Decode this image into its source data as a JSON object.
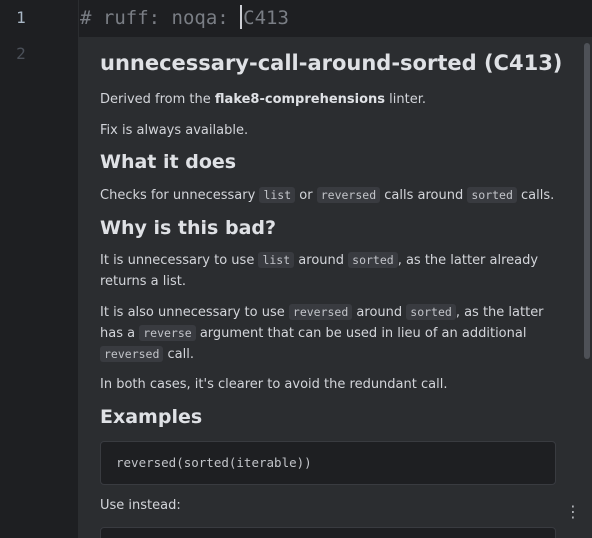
{
  "editor": {
    "line_numbers": [
      "1",
      "2"
    ],
    "line1_before_caret": "# ruff: noqa: ",
    "line1_after_caret": "C413"
  },
  "doc": {
    "title": "unnecessary-call-around-sorted (C413)",
    "derived_prefix": "Derived from the ",
    "derived_linter": "flake8-comprehensions",
    "derived_suffix": " linter.",
    "fix": "Fix is always available.",
    "what_heading": "What it does",
    "what_1": "Checks for unnecessary ",
    "what_code_list": "list",
    "what_2": " or ",
    "what_code_reversed": "reversed",
    "what_3": " calls around ",
    "what_code_sorted": "sorted",
    "what_4": " calls.",
    "why_heading": "Why is this bad?",
    "why1_1": "It is unnecessary to use ",
    "why1_code_list": "list",
    "why1_2": " around ",
    "why1_code_sorted": "sorted",
    "why1_3": ", as the latter already returns a list.",
    "why2_1": "It is also unnecessary to use ",
    "why2_code_reversed": "reversed",
    "why2_2": " around ",
    "why2_code_sorted": "sorted",
    "why2_3": ", as the latter has a ",
    "why2_code_reverse": "reverse",
    "why2_4": " argument that can be used in lieu of an additional ",
    "why2_code_reversed2": "reversed",
    "why2_5": " call.",
    "why3": "In both cases, it's clearer to avoid the redundant call.",
    "examples_heading": "Examples",
    "example_code": "reversed(sorted(iterable))",
    "use_instead": "Use instead:",
    "more_icon": "⋮"
  }
}
